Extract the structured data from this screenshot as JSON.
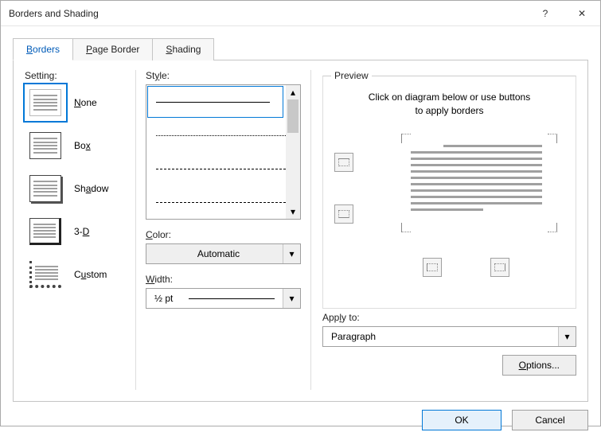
{
  "window": {
    "title": "Borders and Shading",
    "help": "?",
    "close": "✕"
  },
  "tabs": {
    "borders": "Borders",
    "page_border": "Page Border",
    "shading": "Shading",
    "borders_key": "B",
    "page_border_key": "P",
    "shading_key": "S"
  },
  "setting": {
    "label": "Setting:",
    "items": [
      {
        "label": "None",
        "key": "N"
      },
      {
        "label": "Box",
        "key": "x"
      },
      {
        "label": "Shadow",
        "key": "A"
      },
      {
        "label": "3-D",
        "key": "D"
      },
      {
        "label": "Custom",
        "key": "U"
      }
    ]
  },
  "style": {
    "label": "Style:",
    "key": "Y"
  },
  "color": {
    "label": "Color:",
    "key": "C",
    "value": "Automatic"
  },
  "width": {
    "label": "Width:",
    "key": "W",
    "value": "½ pt"
  },
  "preview": {
    "legend": "Preview",
    "line1": "Click on diagram below or use buttons",
    "line2": "to apply borders"
  },
  "applyto": {
    "label": "Apply to:",
    "key": "L",
    "value": "Paragraph"
  },
  "buttons": {
    "options": "Options...",
    "options_key": "O",
    "ok": "OK",
    "cancel": "Cancel"
  }
}
